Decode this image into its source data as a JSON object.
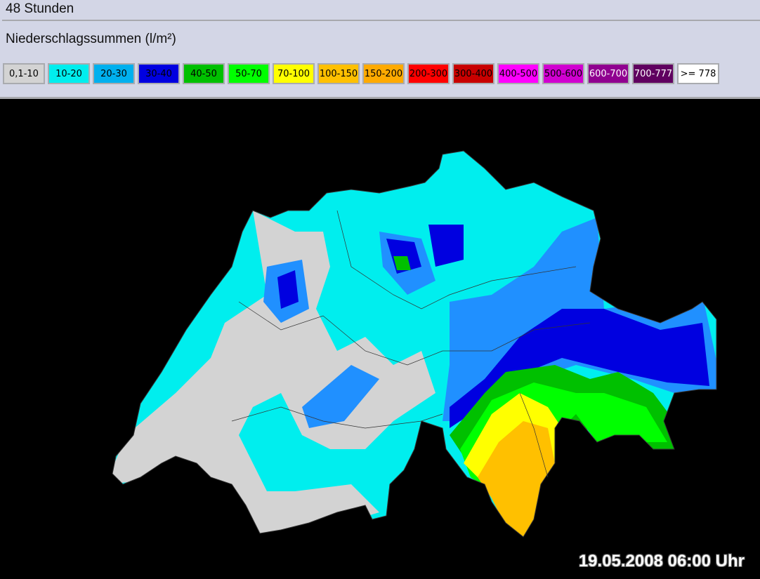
{
  "header": {
    "title": "48 Stunden",
    "subtitle": "Niederschlagssummen (l/m²)"
  },
  "legend": [
    {
      "label": "0,1-10",
      "color": "#d3d3d3",
      "text": "#000"
    },
    {
      "label": "10-20",
      "color": "#00eeee",
      "text": "#000"
    },
    {
      "label": "20-30",
      "color": "#00b0ee",
      "text": "#000"
    },
    {
      "label": "30-40",
      "color": "#0000e0",
      "text": "#000"
    },
    {
      "label": "40-50",
      "color": "#00c000",
      "text": "#000"
    },
    {
      "label": "50-70",
      "color": "#00ff00",
      "text": "#000"
    },
    {
      "label": "70-100",
      "color": "#ffff00",
      "text": "#000"
    },
    {
      "label": "100-150",
      "color": "#ffc000",
      "text": "#000"
    },
    {
      "label": "150-200",
      "color": "#ffaa00",
      "text": "#000"
    },
    {
      "label": "200-300",
      "color": "#ff0000",
      "text": "#000"
    },
    {
      "label": "300-400",
      "color": "#c80000",
      "text": "#000"
    },
    {
      "label": "400-500",
      "color": "#ff00ff",
      "text": "#000"
    },
    {
      "label": "500-600",
      "color": "#d000d0",
      "text": "#000"
    },
    {
      "label": "600-700",
      "color": "#900090",
      "text": "#fff"
    },
    {
      "label": "700-777",
      "color": "#600060",
      "text": "#fff"
    },
    {
      "label": ">= 778",
      "color": "#ffffff",
      "text": "#000"
    }
  ],
  "timestamp": "19.05.2008 06:00 Uhr"
}
